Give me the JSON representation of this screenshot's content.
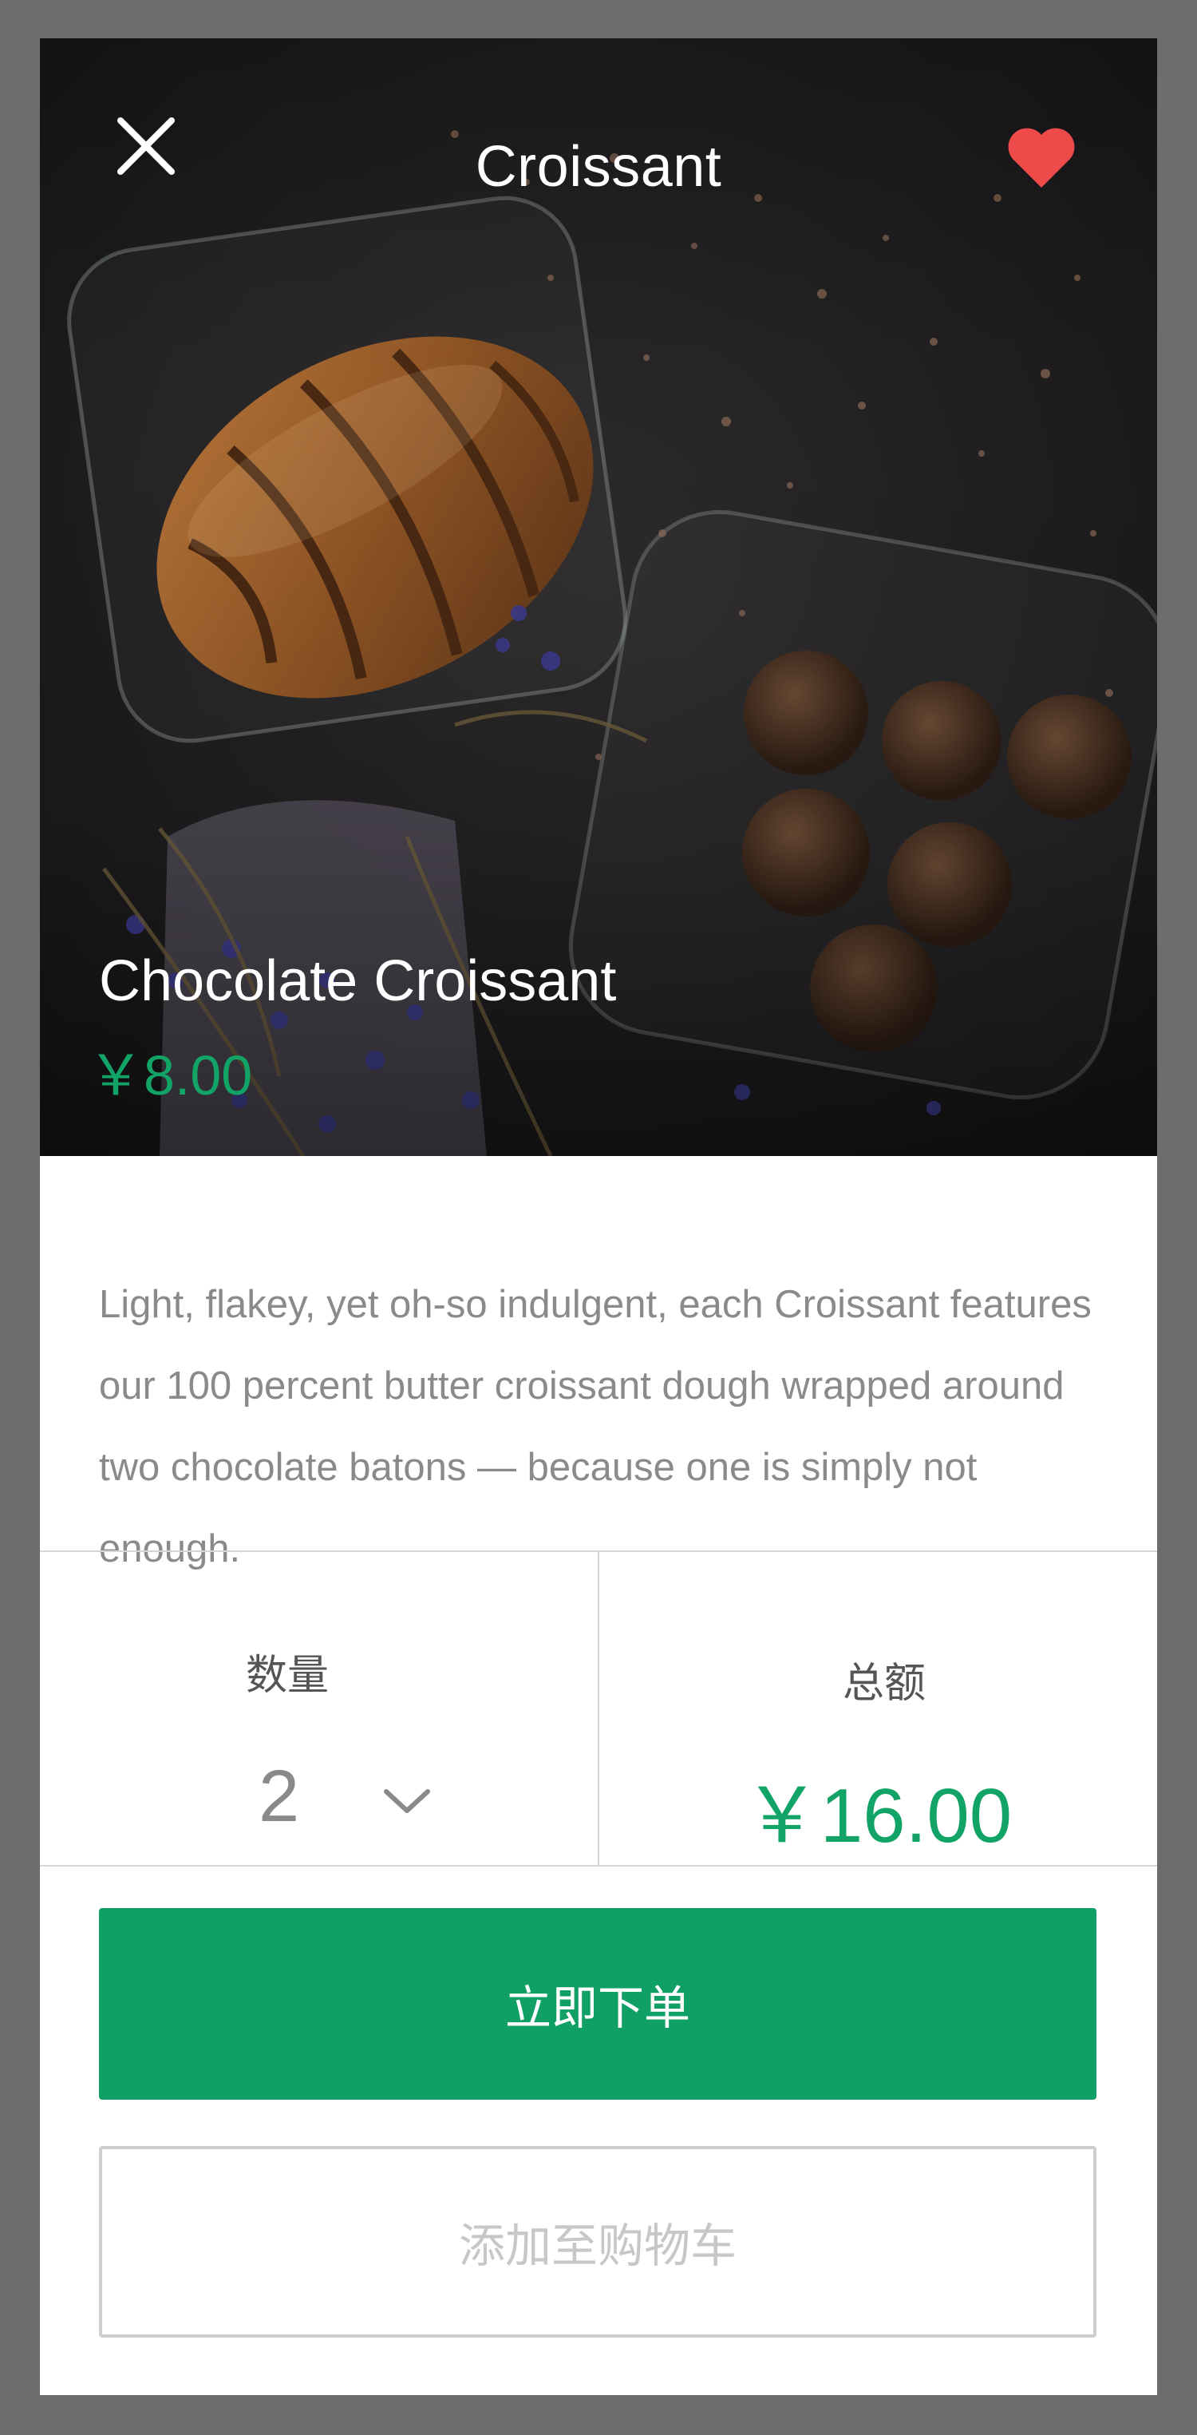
{
  "header": {
    "title": "Croissant",
    "close_icon": "close-icon",
    "favorite_icon": "heart-icon",
    "favorite_color": "#ee4a4a"
  },
  "product": {
    "name": "Chocolate Croissant",
    "price": "￥8.00",
    "description": "Light, flakey, yet oh-so indulgent, each Croissant features our 100 percent butter croissant dough wrapped around two chocolate batons — because one is simply not enough."
  },
  "order": {
    "quantity_label": "数量",
    "quantity_value": "2",
    "quantity_icon": "chevron-down-icon",
    "total_label": "总额",
    "total_value": "￥16.00"
  },
  "actions": {
    "order_now_label": "立即下单",
    "add_to_cart_label": "添加至购物车"
  },
  "colors": {
    "accent": "#10a066",
    "price_text": "#12a366",
    "background": "#6d6d6d"
  }
}
